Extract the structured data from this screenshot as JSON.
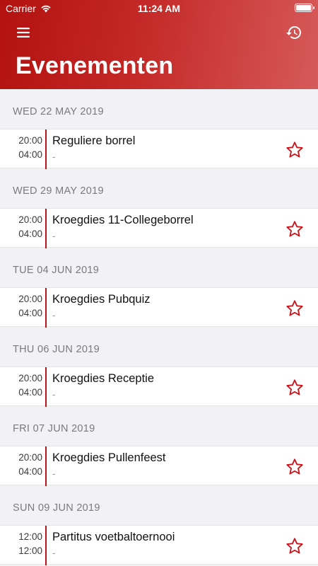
{
  "status_bar": {
    "carrier": "Carrier",
    "time": "11:24 AM"
  },
  "header": {
    "title": "Evenementen",
    "menu_icon": "hamburger-menu-icon",
    "history_icon": "history-icon"
  },
  "colors": {
    "accent": "#b8141a",
    "header_start": "#b2110f",
    "header_end": "#d65a5a"
  },
  "days": [
    {
      "date": "WED 22 MAY 2019",
      "event": {
        "start": "20:00",
        "end": "04:00",
        "title": "Reguliere borrel",
        "subtitle": "-"
      }
    },
    {
      "date": "WED 29 MAY 2019",
      "event": {
        "start": "20:00",
        "end": "04:00",
        "title": "Kroegdies 11-Collegeborrel",
        "subtitle": "-"
      }
    },
    {
      "date": "TUE 04 JUN 2019",
      "event": {
        "start": "20:00",
        "end": "04:00",
        "title": "Kroegdies Pubquiz",
        "subtitle": "-"
      }
    },
    {
      "date": "THU 06 JUN 2019",
      "event": {
        "start": "20:00",
        "end": "04:00",
        "title": "Kroegdies Receptie",
        "subtitle": "-"
      }
    },
    {
      "date": "FRI 07 JUN 2019",
      "event": {
        "start": "20:00",
        "end": "04:00",
        "title": "Kroegdies Pullenfeest",
        "subtitle": "-"
      }
    },
    {
      "date": "SUN 09 JUN 2019",
      "event": {
        "start": "12:00",
        "end": "12:00",
        "title": "Partitus voetbaltoernooi",
        "subtitle": "-"
      }
    }
  ]
}
